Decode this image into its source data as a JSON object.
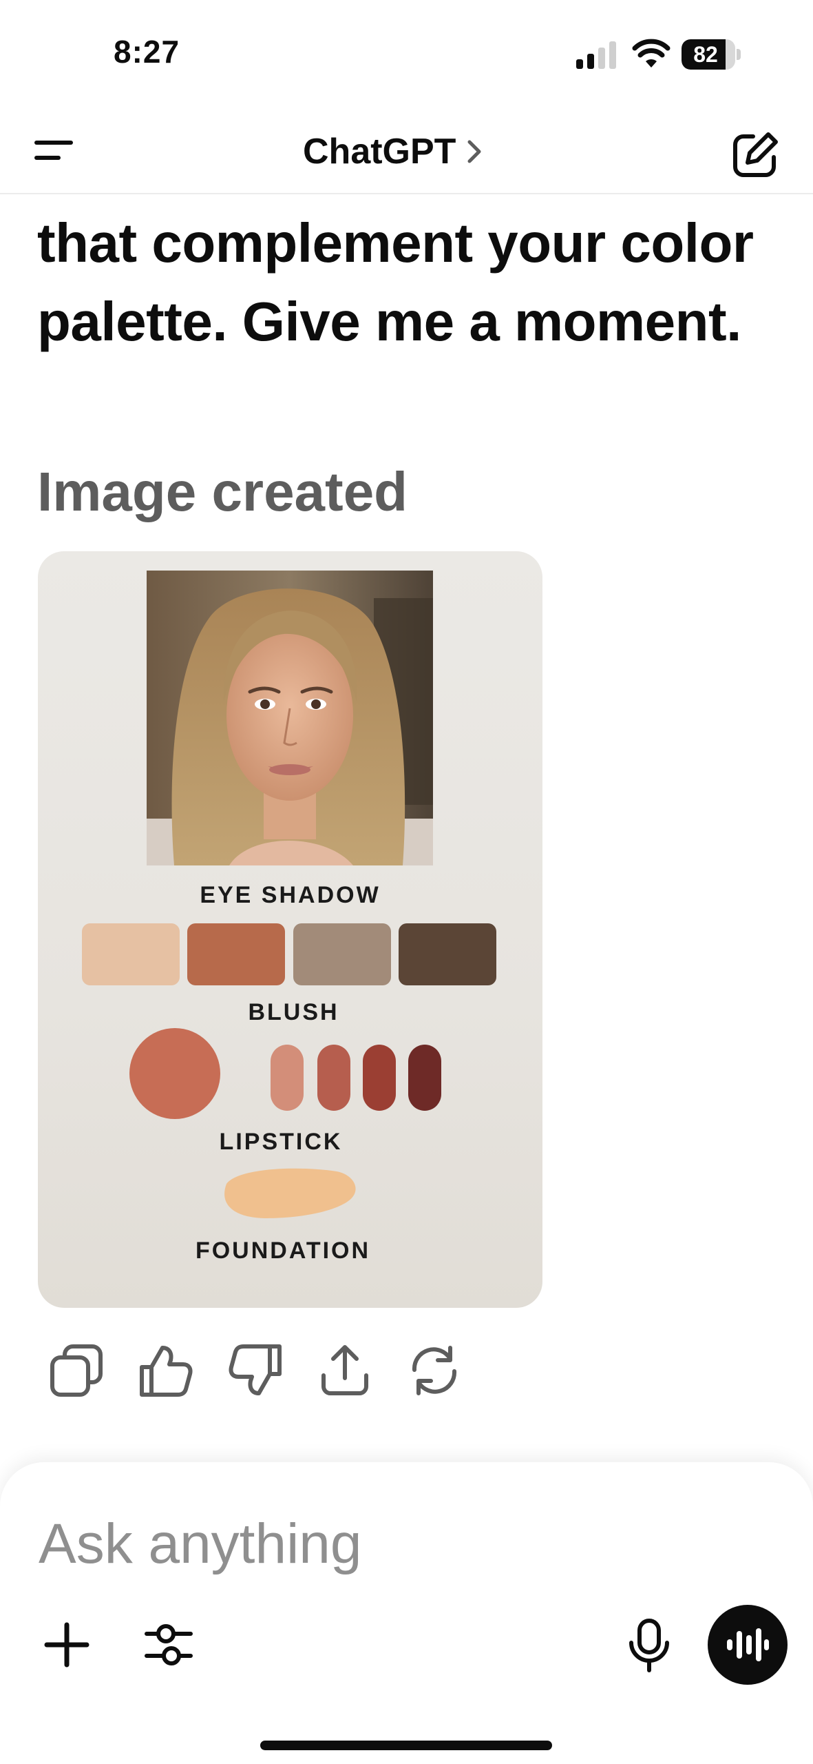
{
  "status_bar": {
    "time": "8:27",
    "battery_level": "82"
  },
  "nav": {
    "title": "ChatGPT",
    "icons": {
      "menu": "menu-icon",
      "title_chevron": "chevron-right-icon",
      "new_chat": "new-chat-icon"
    }
  },
  "conversation": {
    "message_text": "that complement your color palette. Give me a moment.",
    "image_status": "Image created",
    "generated_image": {
      "labels": {
        "eye_shadow": "EYE SHADOW",
        "blush": "BLUSH",
        "lipstick": "LIPSTICK",
        "foundation": "FOUNDATION"
      },
      "eye_shadow_colors": [
        "#e6c1a3",
        "#b76a4b",
        "#a28b79",
        "#5b4536"
      ],
      "blush_color": "#c76d55",
      "lipstick_colors": [
        "#d38e79",
        "#b65e4e",
        "#9b3f33",
        "#6e2a27"
      ],
      "foundation_color": "#f0c08e"
    },
    "actions": [
      {
        "name": "copy",
        "icon": "copy-icon"
      },
      {
        "name": "thumbs-up",
        "icon": "thumbs-up-icon"
      },
      {
        "name": "thumbs-down",
        "icon": "thumbs-down-icon"
      },
      {
        "name": "share",
        "icon": "share-icon"
      },
      {
        "name": "regenerate",
        "icon": "regenerate-icon"
      }
    ]
  },
  "composer": {
    "placeholder": "Ask anything",
    "icons": {
      "add": "plus-icon",
      "tools": "sliders-icon",
      "dictate": "microphone-icon",
      "voice": "voice-waveform-icon"
    }
  },
  "colors": {
    "text_primary": "#0d0d0d",
    "text_secondary": "#5d5d5d",
    "placeholder": "#8f8f8f",
    "card_background": "#e9e6e1"
  }
}
